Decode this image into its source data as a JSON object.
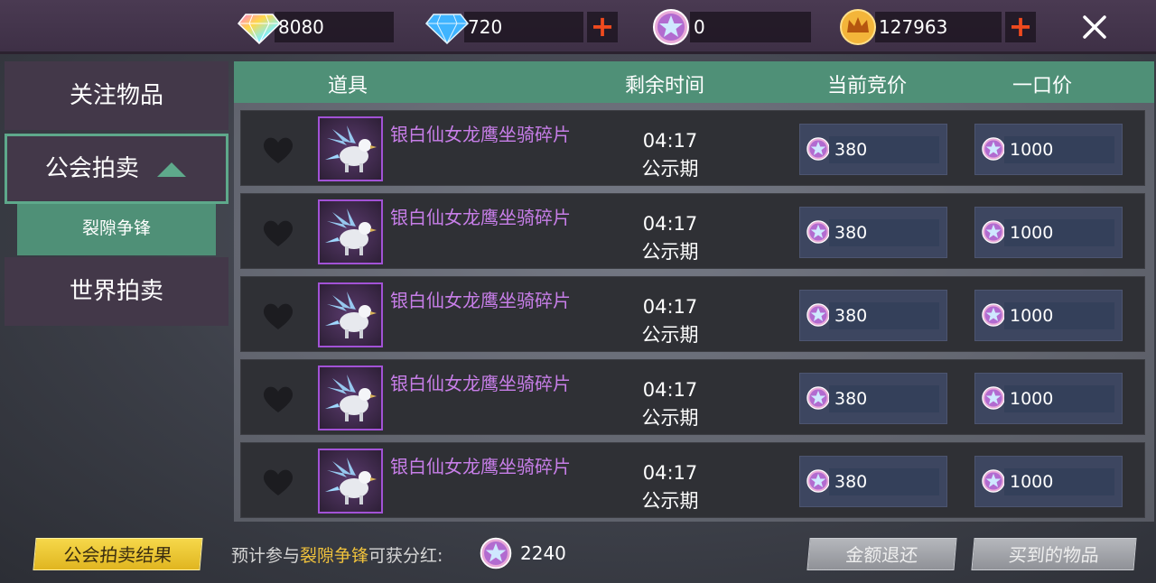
{
  "currencies": {
    "rainbow_gem": "8080",
    "blue_diamond": "720",
    "star_coin": "0",
    "crown_gold": "127963",
    "plus_symbol": "+"
  },
  "sidebar": {
    "items": [
      {
        "label": "关注物品"
      },
      {
        "label": "公会拍卖"
      },
      {
        "label": "世界拍卖"
      }
    ],
    "sub_item": "裂隙争锋"
  },
  "table": {
    "headers": [
      "道具",
      "剩余时间",
      "当前竞价",
      "一口价"
    ],
    "rows": [
      {
        "name": "银白仙女龙鹰坐骑碎片",
        "time": "04:17",
        "status": "公示期",
        "current_bid": "380",
        "buyout": "1000"
      },
      {
        "name": "银白仙女龙鹰坐骑碎片",
        "time": "04:17",
        "status": "公示期",
        "current_bid": "380",
        "buyout": "1000"
      },
      {
        "name": "银白仙女龙鹰坐骑碎片",
        "time": "04:17",
        "status": "公示期",
        "current_bid": "380",
        "buyout": "1000"
      },
      {
        "name": "银白仙女龙鹰坐骑碎片",
        "time": "04:17",
        "status": "公示期",
        "current_bid": "380",
        "buyout": "1000"
      },
      {
        "name": "银白仙女龙鹰坐骑碎片",
        "time": "04:17",
        "status": "公示期",
        "current_bid": "380",
        "buyout": "1000"
      }
    ]
  },
  "bottom": {
    "result_button": "公会拍卖结果",
    "dividend_prefix": "预计参与",
    "dividend_highlight": "裂隙争锋",
    "dividend_suffix": "可获分红:",
    "dividend_value": "2240",
    "refund_button": "金额退还",
    "bought_button": "买到的物品"
  },
  "colors": {
    "accent_green": "#4f9077",
    "item_name_purple": "#c77ee8",
    "plus_orange": "#f04a1e",
    "highlight_gold": "#f0c23c"
  }
}
